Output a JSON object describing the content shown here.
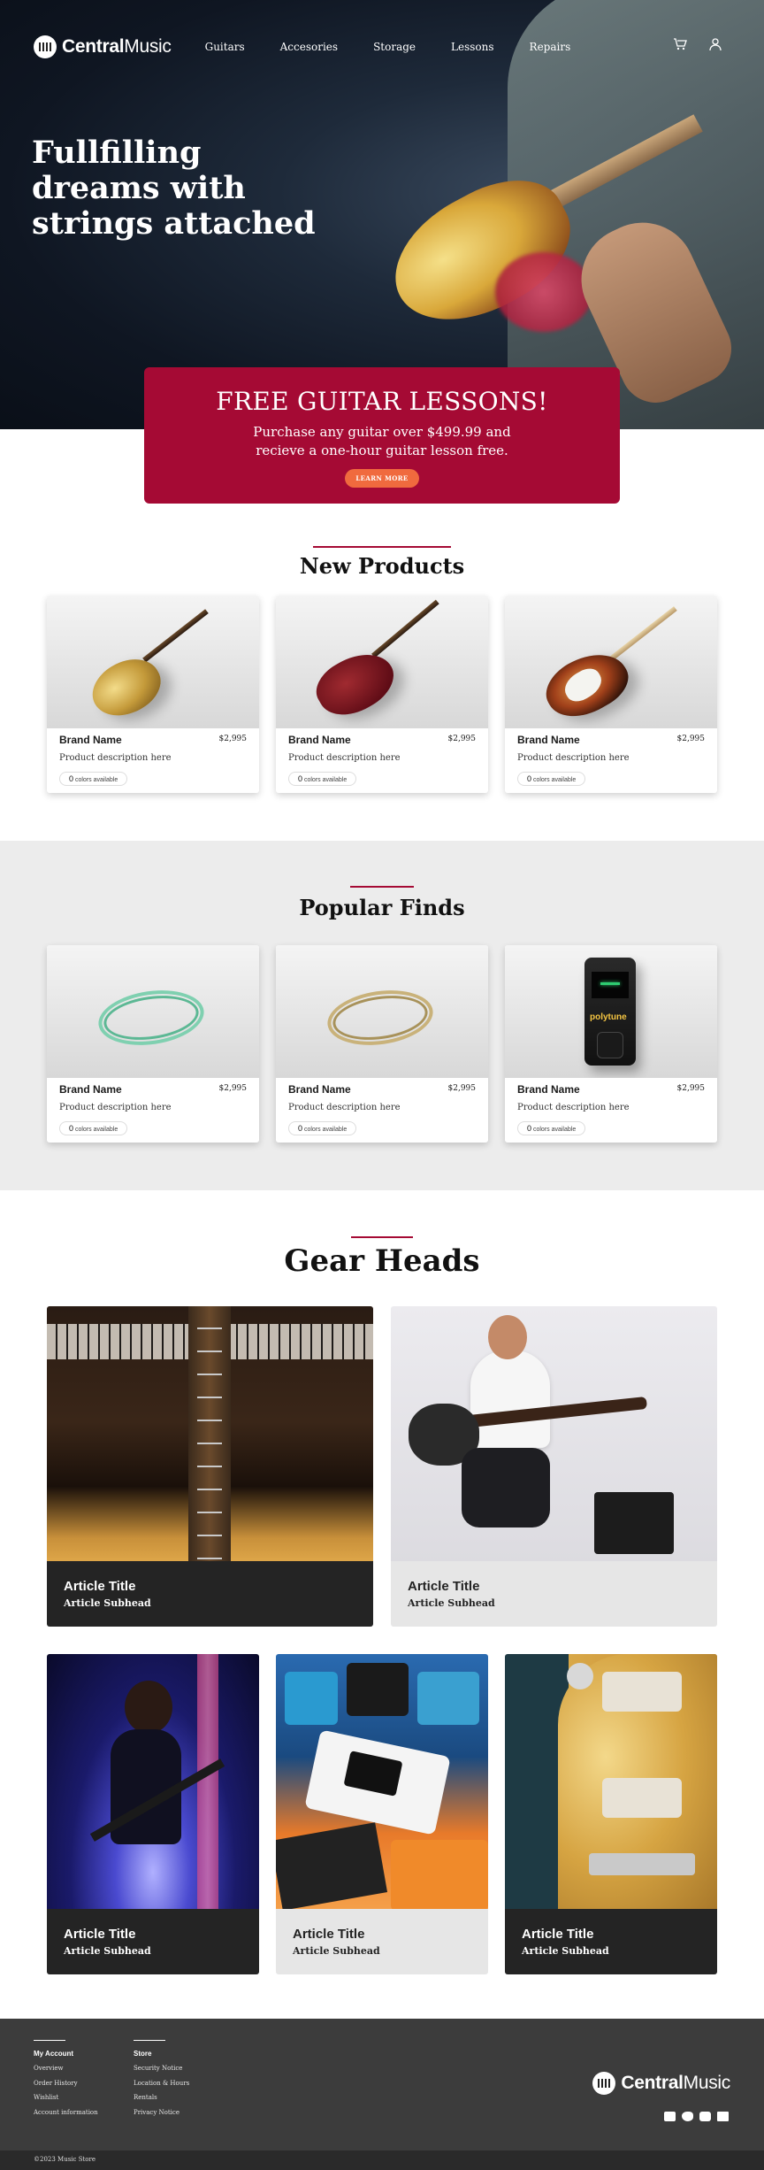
{
  "brand": {
    "name_bold": "Central",
    "name_rest": "Music"
  },
  "nav": {
    "links": [
      "Guitars",
      "Accesories",
      "Storage",
      "Lessons",
      "Repairs"
    ]
  },
  "header_icons": [
    "cart-icon",
    "user-icon"
  ],
  "hero": {
    "title": "Fullfilling dreams with strings attached"
  },
  "promo": {
    "title": "FREE GUITAR LESSONS!",
    "line1": "Purchase any guitar over $499.99 and",
    "line2": "recieve a one-hour guitar lesson free.",
    "button": "LEARN MORE",
    "color": "#a50a34",
    "button_color": "#f06a3e"
  },
  "new_products": {
    "title": "New Products",
    "items": [
      {
        "brand": "Brand Name",
        "price": "$2,995",
        "desc": "Product description here",
        "colors_count": "0",
        "colors_label": "colors available"
      },
      {
        "brand": "Brand Name",
        "price": "$2,995",
        "desc": "Product description here",
        "colors_count": "0",
        "colors_label": "colors available"
      },
      {
        "brand": "Brand Name",
        "price": "$2,995",
        "desc": "Product description here",
        "colors_count": "0",
        "colors_label": "colors available"
      }
    ]
  },
  "popular_finds": {
    "title": "Popular Finds",
    "items": [
      {
        "brand": "Brand Name",
        "price": "$2,995",
        "desc": "Product description here",
        "colors_count": "0",
        "colors_label": "colors available"
      },
      {
        "brand": "Brand Name",
        "price": "$2,995",
        "desc": "Product description here",
        "colors_count": "0",
        "colors_label": "colors available"
      },
      {
        "brand": "Brand Name",
        "price": "$2,995",
        "desc": "Product description here",
        "colors_count": "0",
        "colors_label": "colors available"
      }
    ],
    "tuner_label": "polytune"
  },
  "gear_heads": {
    "title": "Gear Heads",
    "articles": [
      {
        "title": "Article Title",
        "sub": "Article Subhead"
      },
      {
        "title": "Article Title",
        "sub": "Article Subhead"
      },
      {
        "title": "Article Title",
        "sub": "Article Subhead"
      },
      {
        "title": "Article Title",
        "sub": "Article Subhead"
      },
      {
        "title": "Article Title",
        "sub": "Article Subhead"
      }
    ]
  },
  "footer": {
    "account": {
      "heading": "My Account",
      "items": [
        "Overview",
        "Order History",
        "Wishlist",
        "Account information"
      ]
    },
    "store": {
      "heading": "Store",
      "items": [
        "Security Notice",
        "Location & Hours",
        "Rentals",
        "Privacy Notice"
      ]
    },
    "social": [
      "youtube-icon",
      "twitter-icon",
      "instagram-icon",
      "facebook-icon"
    ],
    "copyright": "©2023 Music Store"
  }
}
